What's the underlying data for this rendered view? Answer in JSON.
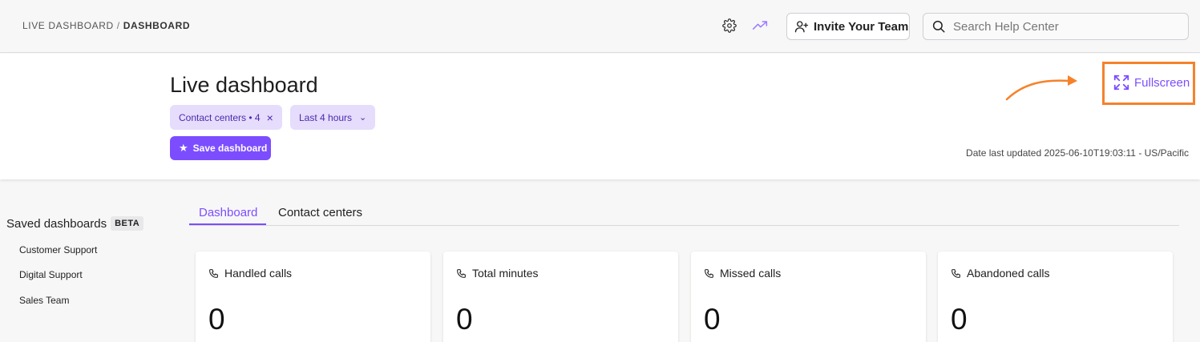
{
  "breadcrumb": {
    "parent": "LIVE DASHBOARD",
    "separator": "/",
    "current": "DASHBOARD"
  },
  "topbar": {
    "settings_icon": "gear-icon",
    "trend_icon": "trending-up-icon",
    "invite_label": "Invite Your Team",
    "search_placeholder": "Search Help Center"
  },
  "header": {
    "title": "Live dashboard",
    "filters": [
      {
        "label": "Contact centers • 4",
        "action": "×"
      },
      {
        "label": "Last 4 hours",
        "action": "⌄"
      }
    ],
    "save_label": "Save dashboard",
    "fullscreen_label": "Fullscreen",
    "date_updated": "Date last updated 2025-06-10T19:03:11 - US/Pacific"
  },
  "sidebar": {
    "title": "Saved dashboards",
    "badge": "BETA",
    "items": [
      "Customer Support",
      "Digital Support",
      "Sales Team"
    ]
  },
  "tabs": [
    {
      "label": "Dashboard",
      "active": true
    },
    {
      "label": "Contact centers",
      "active": false
    }
  ],
  "cards": [
    {
      "title": "Handled calls",
      "value": "0",
      "icon": "phone-icon"
    },
    {
      "title": "Total minutes",
      "value": "0",
      "icon": "phone-icon"
    },
    {
      "title": "Missed calls",
      "value": "0",
      "icon": "phone-icon"
    },
    {
      "title": "Abandoned calls",
      "value": "0",
      "icon": "phone-icon"
    }
  ],
  "colors": {
    "accent": "#7c4dff",
    "chip_bg": "#e6dcfb",
    "highlight": "#f5822a"
  }
}
